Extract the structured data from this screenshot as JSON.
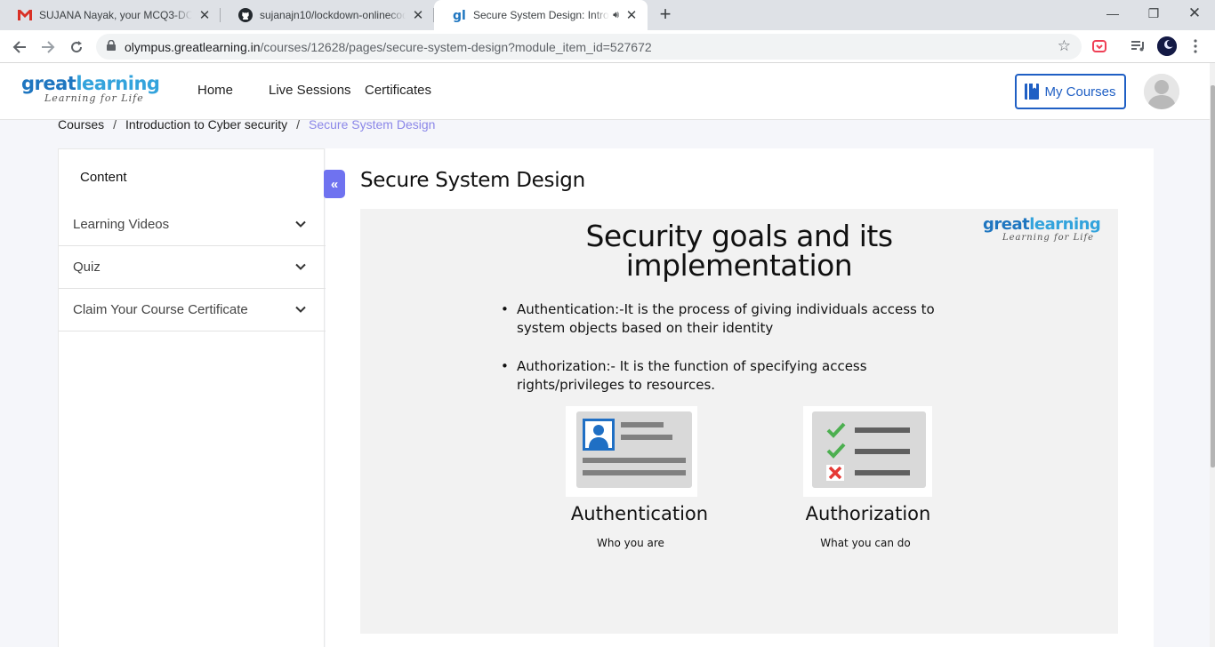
{
  "browser": {
    "tabs": [
      {
        "title": "SUJANA Nayak, your MCQ3-DC r",
        "icon": "gmail-icon"
      },
      {
        "title": "sujanajn10/lockdown-onlinecodi",
        "icon": "github-icon"
      },
      {
        "title": "Secure System Design: Introd",
        "icon": "greatlearning-icon"
      }
    ],
    "url_domain": "olympus.greatlearning.in",
    "url_path": "/courses/12628/pages/secure-system-design?module_item_id=527672"
  },
  "header": {
    "logo_main_a": "great",
    "logo_main_b": "learning",
    "logo_tagline": "Learning for Life",
    "nav": [
      "Home",
      "Live Sessions",
      "Certificates"
    ],
    "my_courses": "My Courses"
  },
  "breadcrumb": {
    "items": [
      "Courses",
      "Introduction to Cyber security"
    ],
    "current": "Secure System Design",
    "separator": "/"
  },
  "sidebar": {
    "heading": "Content",
    "sections": [
      "Learning Videos",
      "Quiz",
      "Claim Your Course Certificate"
    ]
  },
  "main": {
    "title": "Secure System Design",
    "slide": {
      "title_line1": "Security goals and its",
      "title_line2": "implementation",
      "bullets": [
        "Authentication:-It is the process of giving individuals access to system objects based on their identity",
        "Authorization:- It is the function of specifying access rights/privileges to resources."
      ],
      "auth_title": "Authentication",
      "auth_sub": "Who you are",
      "authz_title": "Authorization",
      "authz_sub": "What you can do"
    }
  },
  "colors": {
    "accent": "#6f72f0",
    "brand_blue": "#1f5fc4",
    "breadcrumb_current": "#8b87e8"
  }
}
